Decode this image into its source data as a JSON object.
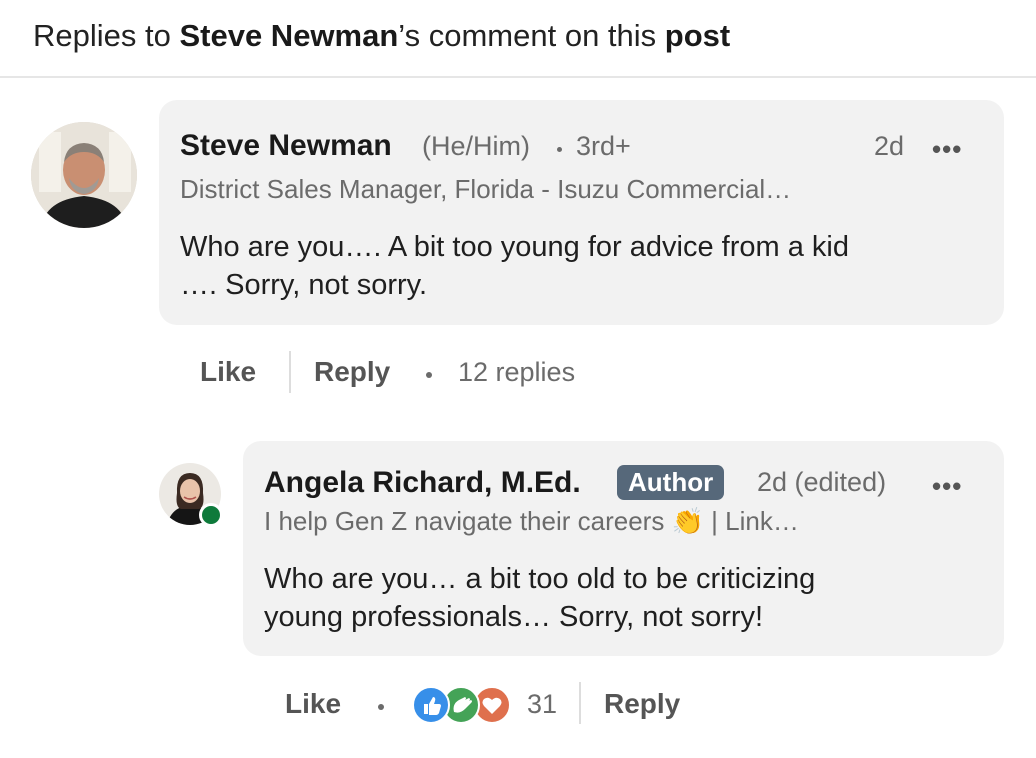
{
  "header": {
    "prefix": "Replies to ",
    "name": "Steve Newman",
    "middle": "’s comment on this ",
    "post": "post"
  },
  "comments": [
    {
      "author": "Steve Newman",
      "pronouns": "(He/Him)",
      "degree": "3rd+",
      "time": "2d",
      "headline": "District Sales Manager, Florida - Isuzu Commercial…",
      "text_line1": "Who are you…. A bit too young for advice from a kid",
      "text_line2": "…. Sorry, not sorry.",
      "actions": {
        "like": "Like",
        "reply": "Reply",
        "replies": "12 replies"
      }
    },
    {
      "author": "Angela Richard, M.Ed.",
      "badge": "Author",
      "time": "2d (edited)",
      "headline_pre": "I help Gen Z navigate their careers ",
      "headline_emoji": "👏",
      "headline_post": " | Link…",
      "text_line1": "Who are you… a bit too old to be criticizing",
      "text_line2": "young professionals… Sorry, not sorry!",
      "actions": {
        "like": "Like",
        "reactions": "31",
        "reply": "Reply"
      },
      "online": true
    }
  ],
  "icons": {
    "more": "•••",
    "reactions": [
      "like-reaction-icon",
      "celebrate-reaction-icon",
      "love-reaction-icon"
    ]
  },
  "colors": {
    "bubble": "#f2f2f2",
    "badge": "#56687a",
    "online": "#0e7a3b",
    "like": "#378fe9",
    "celebrate": "#44a357",
    "love": "#df704d"
  }
}
